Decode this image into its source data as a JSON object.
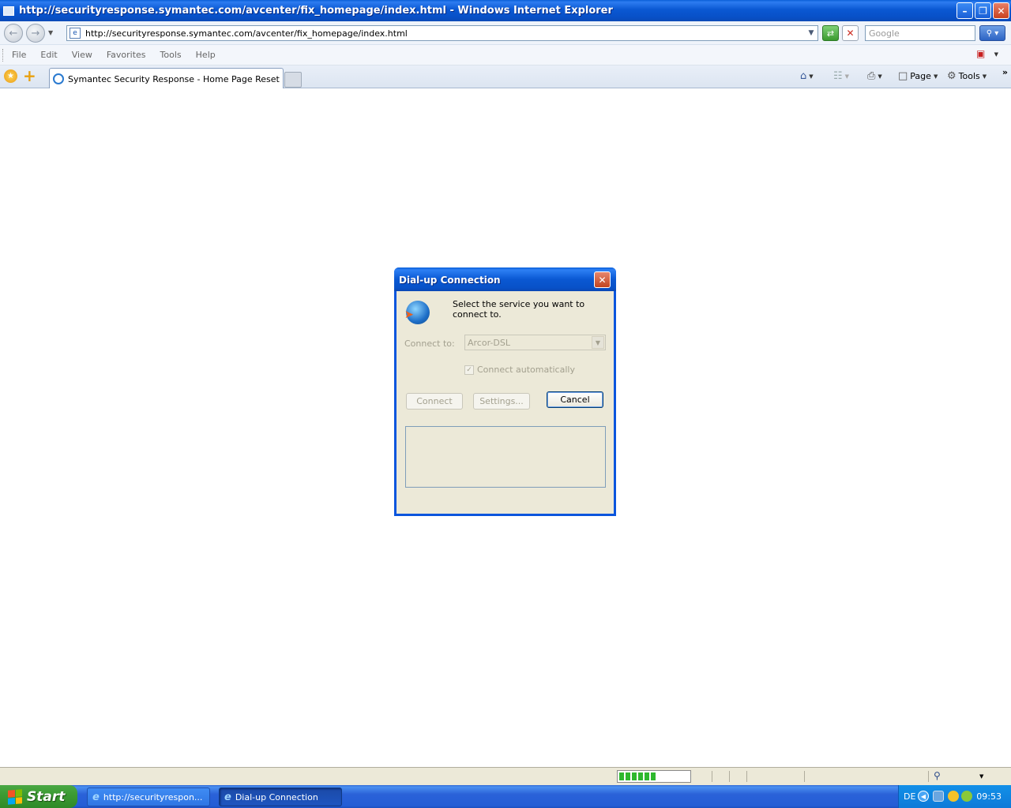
{
  "window": {
    "title": "http://securityresponse.symantec.com/avcenter/fix_homepage/index.html - Windows Internet Explorer"
  },
  "address": {
    "url": "http://securityresponse.symantec.com/avcenter/fix_homepage/index.html",
    "search_placeholder": "Google"
  },
  "menu": {
    "items": [
      "File",
      "Edit",
      "View",
      "Favorites",
      "Tools",
      "Help"
    ]
  },
  "tabs": {
    "active_label": "Symantec Security Response - Home Page Reset"
  },
  "command_bar": {
    "page_label": "Page",
    "tools_label": "Tools",
    "more": "»"
  },
  "dialog": {
    "title": "Dial-up Connection",
    "message": "Select the service you want to connect to.",
    "connect_to_label": "Connect to:",
    "connect_to_value": "Arcor-DSL",
    "auto_connect_label": "Connect automatically",
    "auto_connect_checked": true,
    "connect_button": "Connect",
    "settings_button": "Settings...",
    "cancel_button": "Cancel"
  },
  "statusbar": {
    "progress_fraction": 0.55
  },
  "taskbar": {
    "start_label": "Start",
    "items": [
      "http://securityrespon...",
      "Dial-up Connection"
    ],
    "language": "DE",
    "clock": "09:53"
  },
  "colors": {
    "xp_blue": "#0a58d3",
    "start_green": "#3c9b33",
    "dialog_face": "#ece9d8",
    "disabled_text": "#a3a08f"
  }
}
